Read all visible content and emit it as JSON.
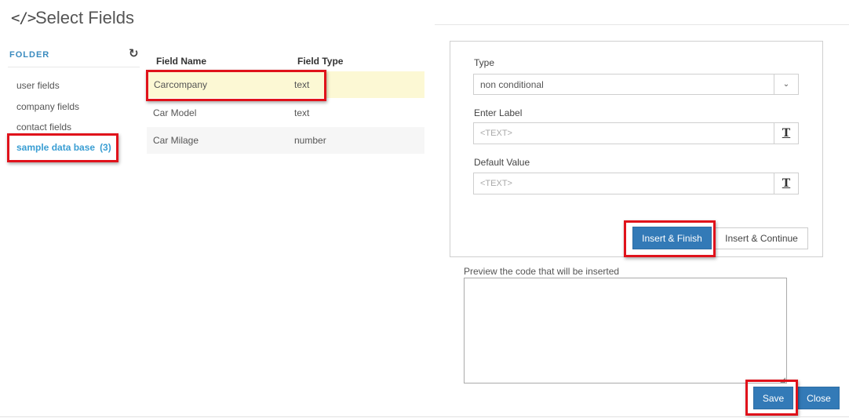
{
  "header": {
    "icon": "</>",
    "title": "Select Fields"
  },
  "folder": {
    "label": "FOLDER",
    "refresh_icon": "refresh-icon",
    "items": [
      {
        "label": "user fields"
      },
      {
        "label": "company fields"
      },
      {
        "label": "contact fields"
      }
    ],
    "active": {
      "label": "sample data base",
      "count": "(3)"
    }
  },
  "fields_table": {
    "headers": [
      "Field Name",
      "Field Type"
    ],
    "rows": [
      {
        "name": "Carcompany",
        "type": "text"
      },
      {
        "name": "Car Model",
        "type": "text"
      },
      {
        "name": "Car Milage",
        "type": "number"
      }
    ]
  },
  "form": {
    "type_label": "Type",
    "type_value": "non conditional",
    "label_label": "Enter Label",
    "label_placeholder": "<TEXT>",
    "default_label": "Default Value",
    "default_placeholder": "<TEXT>",
    "insert_finish": "Insert & Finish",
    "insert_continue": "Insert & Continue"
  },
  "preview": {
    "label": "Preview the code that will be inserted",
    "value": ""
  },
  "footer": {
    "save": "Save",
    "close": "Close"
  },
  "colors": {
    "primary": "#337ab7",
    "accent_link": "#3a9ed3",
    "highlight": "#e0121b",
    "selected_row": "#fcf8d4"
  }
}
